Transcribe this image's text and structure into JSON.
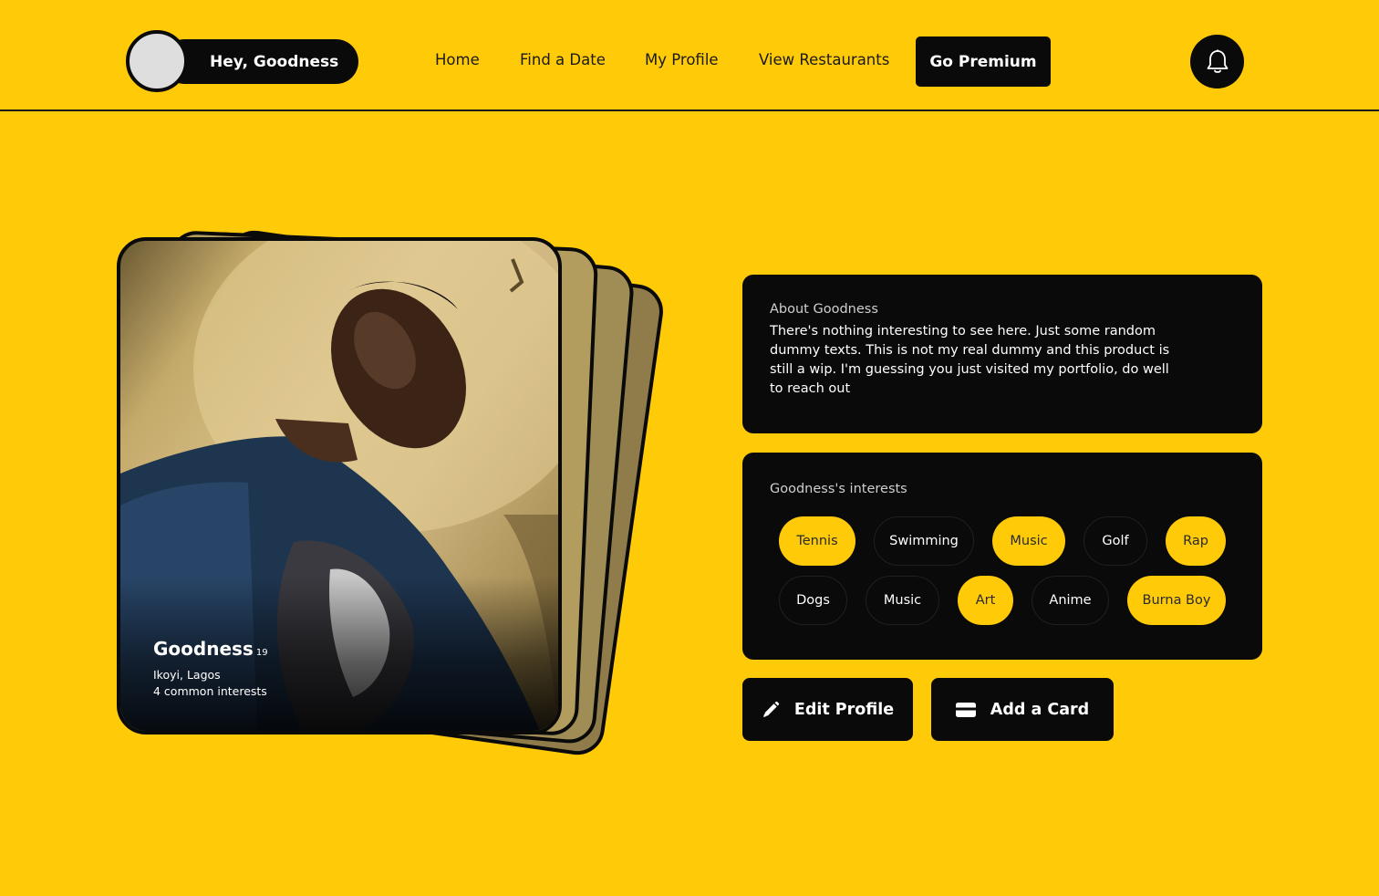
{
  "header": {
    "greeting": "Hey, Goodness",
    "nav": [
      "Home",
      "Find a Date",
      "My Profile",
      "View Restaurants"
    ],
    "premium_label": "Go Premium",
    "icons": {
      "notification": "bell-icon"
    }
  },
  "profile_card": {
    "name": "Goodness",
    "age": "19",
    "location": "Ikoyi, Lagos",
    "common_interests": "4 common interests"
  },
  "about": {
    "title": "About Goodness",
    "text": "There's nothing interesting to see here. Just some random dummy texts. This is not my real dummy and this product is still a wip. I'm guessing you just visited my portfolio, do well to reach out"
  },
  "interests": {
    "title": "Goodness's interests",
    "row1": [
      {
        "label": "Tennis",
        "active": true
      },
      {
        "label": "Swimming",
        "active": false
      },
      {
        "label": "Music",
        "active": true
      },
      {
        "label": "Golf",
        "active": false
      },
      {
        "label": "Rap",
        "active": true
      }
    ],
    "row2": [
      {
        "label": "Dogs",
        "active": false
      },
      {
        "label": "Music",
        "active": false
      },
      {
        "label": "Art",
        "active": true
      },
      {
        "label": "Anime",
        "active": false
      },
      {
        "label": "Burna Boy",
        "active": true
      }
    ]
  },
  "actions": {
    "edit_label": "Edit Profile",
    "add_card_label": "Add a Card",
    "icons": {
      "edit": "pencil-icon",
      "card": "credit-card-icon"
    }
  },
  "colors": {
    "accent": "#FFCA08",
    "dark": "#0A0A0A"
  }
}
